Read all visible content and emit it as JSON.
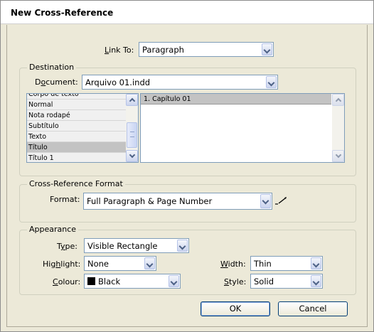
{
  "window": {
    "title": "New Cross-Reference"
  },
  "link_to": {
    "label": "Link To:",
    "value": "Paragraph"
  },
  "destination": {
    "legend": "Destination",
    "document_label": "Document:",
    "document_value": "Arquivo 01.indd",
    "styles": [
      "Corpo de texto",
      "Normal",
      "Nota rodapé",
      "Subtítulo",
      "Texto",
      "Título",
      "Título 1"
    ],
    "selected_style": "Título",
    "paragraphs": [
      "1. Capítulo 01"
    ]
  },
  "format_group": {
    "legend": "Cross-Reference Format",
    "format_label": "Format:",
    "format_value": "Full Paragraph & Page Number"
  },
  "appearance": {
    "legend": "Appearance",
    "type_label": "Type:",
    "type_value": "Visible Rectangle",
    "highlight_label": "Highlight:",
    "highlight_value": "None",
    "colour_label": "Colour:",
    "colour_value": "Black",
    "colour_swatch": "#000000",
    "width_label": "Width:",
    "width_value": "Thin",
    "style_label": "Style:",
    "style_value": "Solid"
  },
  "buttons": {
    "ok": "OK",
    "cancel": "Cancel"
  }
}
